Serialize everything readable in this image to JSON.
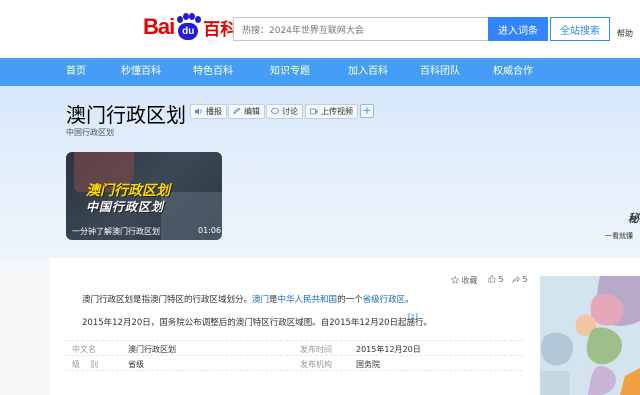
{
  "header": {
    "logo": {
      "left": "Bai",
      "paw": "du",
      "right": "百科"
    },
    "search_placeholder": "热搜：2024年世界互联网大会",
    "btn_enter": "进入词条",
    "btn_search": "全站搜索",
    "help": "帮助"
  },
  "nav": [
    "首页",
    "秒懂百科",
    "特色百科",
    "知识专题",
    "加入百科",
    "百科团队",
    "权威合作"
  ],
  "entry": {
    "title": "澳门行政区划",
    "subtitle": "中国行政区划",
    "tools": {
      "listen": "播报",
      "edit": "编辑",
      "discuss": "讨论",
      "upload": "上传视频",
      "plus": "+"
    },
    "video": {
      "title_line1": "澳门行政区划",
      "title_line2": "中国行政区划",
      "caption": "一分钟了解澳门行政区划",
      "duration": "01:06"
    },
    "banner_deco": {
      "title": "秘",
      "caption": "一看就懂"
    }
  },
  "actions": {
    "collect": "收藏",
    "like_count": "5",
    "share_count": "5"
  },
  "summary": {
    "p1_prefix": "澳门行政区划是指澳门特区的行政区域划分。",
    "p1_link1": "澳门",
    "p1_mid": "是",
    "p1_link2": "中华人民共和国",
    "p1_mid2": "的一个",
    "p1_link3": "省级行政区",
    "p1_end": "。",
    "p2": "2015年12月20日，国务院公布调整后的澳门特区行政区域图。自2015年12月20日起施行。",
    "ref": "[1]"
  },
  "basic_info": [
    {
      "l1": "中文名",
      "v1": "澳门行政区划",
      "l2": "发布时间",
      "v2": "2015年12月20日"
    },
    {
      "l1": "级    别",
      "v1": "省级",
      "l2": "发布机构",
      "v2": "国务院"
    }
  ]
}
